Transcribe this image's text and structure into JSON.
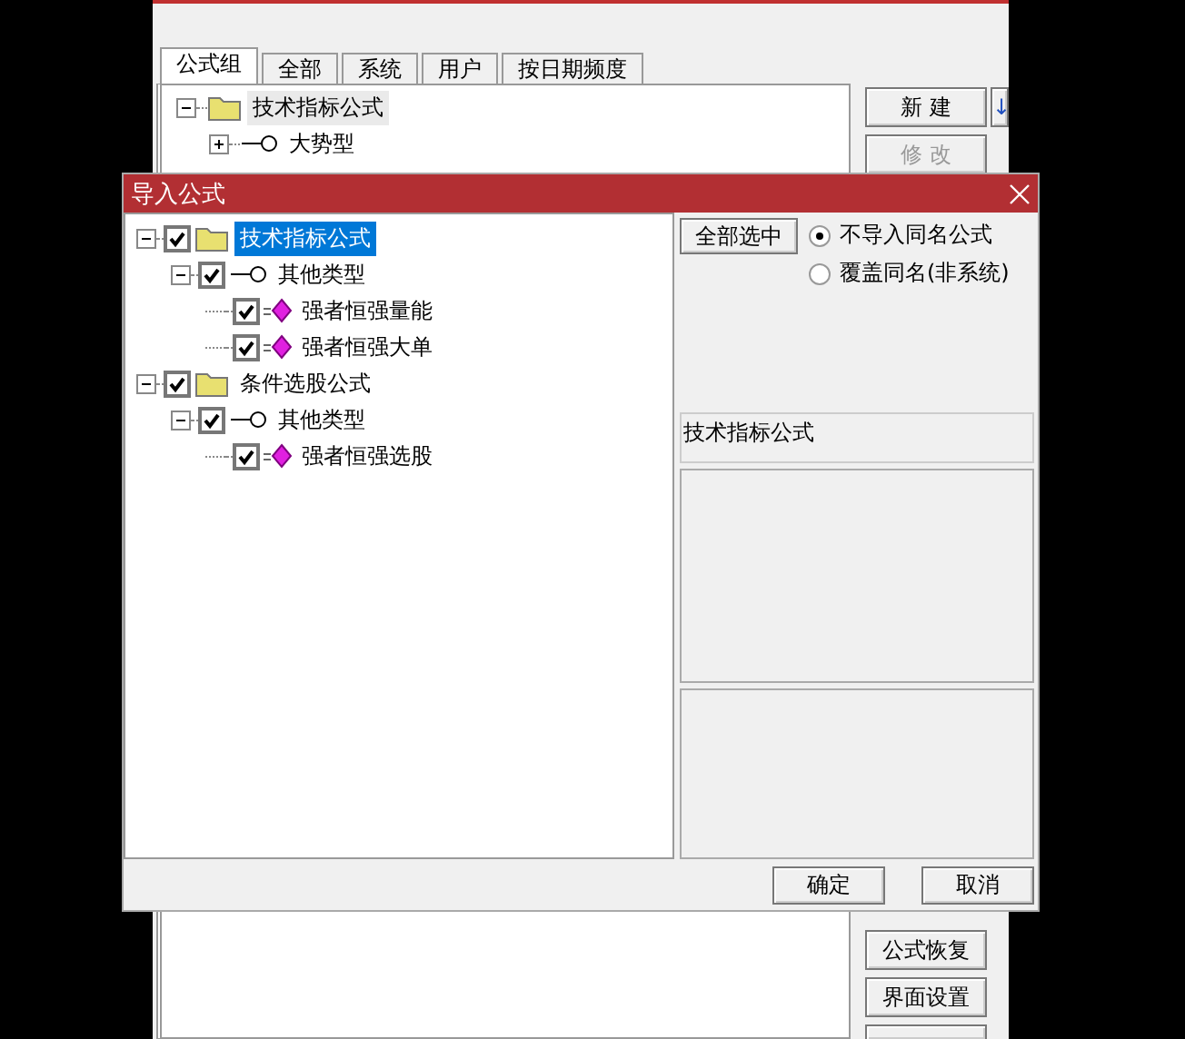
{
  "back_window": {
    "tabs": [
      {
        "label": "公式组",
        "selected": true
      },
      {
        "label": "全部",
        "selected": false
      },
      {
        "label": "系统",
        "selected": false
      },
      {
        "label": "用户",
        "selected": false
      },
      {
        "label": "按日期频度",
        "selected": false
      }
    ],
    "tree": [
      {
        "label": "技术指标公式",
        "kind": "folder",
        "expanded": true,
        "selected": true,
        "children": [
          {
            "label": "大势型",
            "kind": "type",
            "expanded": false,
            "selected": false
          }
        ]
      }
    ],
    "side_buttons": [
      {
        "label": "新 建",
        "disabled": false,
        "arrow": "↓"
      },
      {
        "label": "修 改",
        "disabled": true
      }
    ],
    "bottom_buttons": [
      {
        "label": "公式恢复",
        "disabled": false
      },
      {
        "label": "界面设置",
        "disabled": false
      }
    ]
  },
  "dialog": {
    "title": "导入公式",
    "tree": [
      {
        "label": "技术指标公式",
        "kind": "folder",
        "expanded": true,
        "checked": true,
        "selected": true,
        "children": [
          {
            "label": "其他类型",
            "kind": "type",
            "expanded": true,
            "checked": true,
            "selected": false,
            "children": [
              {
                "label": "强者恒强量能",
                "kind": "formula",
                "checked": true,
                "selected": false
              },
              {
                "label": "强者恒强大单",
                "kind": "formula",
                "checked": true,
                "selected": false
              }
            ]
          }
        ]
      },
      {
        "label": "条件选股公式",
        "kind": "folder",
        "expanded": true,
        "checked": true,
        "selected": false,
        "children": [
          {
            "label": "其他类型",
            "kind": "type",
            "expanded": true,
            "checked": true,
            "selected": false,
            "children": [
              {
                "label": "强者恒强选股",
                "kind": "formula",
                "checked": true,
                "selected": false
              }
            ]
          }
        ]
      }
    ],
    "select_all_button": "全部选中",
    "options": [
      {
        "label": "不导入同名公式",
        "selected": true
      },
      {
        "label": "覆盖同名(非系统)",
        "selected": false
      }
    ],
    "group_name": "技术指标公式",
    "buttons": [
      "确定",
      "取消"
    ]
  }
}
